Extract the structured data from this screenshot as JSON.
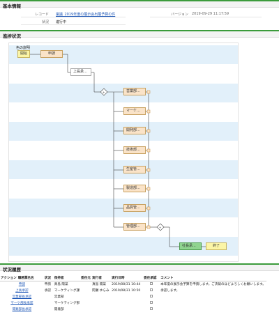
{
  "basic": {
    "title": "基本情報",
    "record_label": "レコード",
    "record_value": "稟議_2019年度の展示会出展予算の件",
    "version_label": "バージョン",
    "version_value": "2019-09-29 11:17:59",
    "status_label": "状況",
    "status_value": "進行中"
  },
  "progress": {
    "title": "進捗状況",
    "legend": "色の説明",
    "nodes": {
      "start": "開始",
      "apply": "申請",
      "manager": "上長承...",
      "d1": "営業部...",
      "d2": "マーケ...",
      "d3": "開発部...",
      "d4": "技術部...",
      "d5": "生産管...",
      "d6": "製造部...",
      "d7": "品質管...",
      "d8": "管理部...",
      "president": "社長承...",
      "end": "終了"
    }
  },
  "history": {
    "title": "状況履歴",
    "columns": [
      "アクション",
      "職務票名名",
      "状況",
      "保持者",
      "委任元",
      "実行者",
      "実行日時",
      "委任承認",
      "コメント"
    ],
    "rows": [
      {
        "action": "申請",
        "status": "申請",
        "holder": "真島 陽菜",
        "delegator": "",
        "executor": "真島 陽菜",
        "datetime": "2019/08/31 10:44",
        "comment": "本年度の展示会予算を申請します。ご決裁のほどよろしくお願いします。"
      },
      {
        "action": "上長承認",
        "status": "承認",
        "holder": "マーケティング課",
        "delegator": "",
        "executor": "間瀬 ゆらみ",
        "datetime": "2019/08/31 10:50",
        "comment": "承認します。"
      },
      {
        "action": "営業部長承認",
        "status": "",
        "holder": "営業部",
        "delegator": "",
        "executor": "",
        "datetime": "",
        "comment": ""
      },
      {
        "action": "マーケ部長承認",
        "status": "",
        "holder": "マーケティング部",
        "delegator": "",
        "executor": "",
        "datetime": "",
        "comment": ""
      },
      {
        "action": "開発部長承認",
        "status": "",
        "holder": "開発部",
        "delegator": "",
        "executor": "",
        "datetime": "",
        "comment": ""
      }
    ]
  }
}
